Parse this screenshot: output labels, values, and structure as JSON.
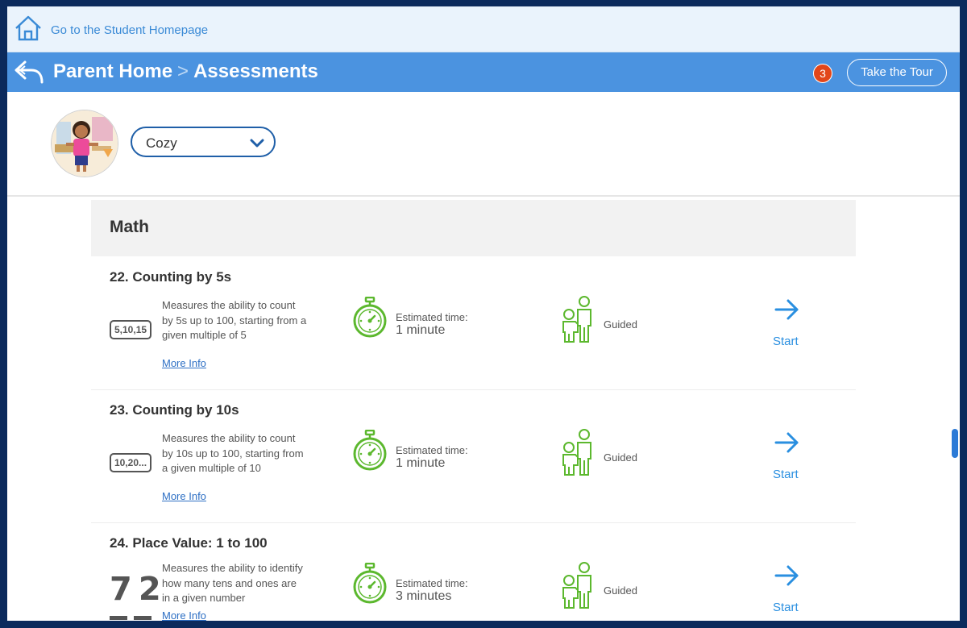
{
  "topbar": {
    "home_link": "Go to the Student Homepage"
  },
  "header": {
    "crumb_home": "Parent Home",
    "crumb_sep": ">",
    "crumb_current": "Assessments",
    "badge_count": "3",
    "tour_button": "Take the Tour"
  },
  "profile": {
    "selected_student": "Cozy"
  },
  "section": {
    "title": "Math"
  },
  "items": [
    {
      "title": "22. Counting by 5s",
      "thumb": "5,10,15",
      "description": "Measures the ability to count by 5s up to 100, starting from a given multiple of 5",
      "more_info": "More Info",
      "est_label": "Estimated time:",
      "est_value": "1 minute",
      "mode": "Guided",
      "start": "Start"
    },
    {
      "title": "23. Counting by 10s",
      "thumb": "10,20...",
      "description": "Measures the ability to count by 10s up to 100, starting from a given multiple of 10",
      "more_info": "More Info",
      "est_label": "Estimated time:",
      "est_value": "1 minute",
      "mode": "Guided",
      "start": "Start"
    },
    {
      "title": "24. Place Value: 1 to 100",
      "thumb": "72",
      "description": "Measures the ability to identify how many tens and ones are in a given number",
      "more_info": "More Info",
      "est_label": "Estimated time:",
      "est_value": "3 minutes",
      "mode": "Guided",
      "start": "Start"
    }
  ],
  "colors": {
    "header_blue": "#4b93e0",
    "link_blue": "#2a8fe0",
    "icon_green": "#5cb82e",
    "badge_red": "#e2461a"
  },
  "icons": {
    "home": "house-outline-icon",
    "back": "curved-back-arrow-icon",
    "dropdown": "chevron-down-icon",
    "timer": "stopwatch-icon",
    "guided": "parent-child-icon",
    "start": "right-arrow-icon"
  }
}
